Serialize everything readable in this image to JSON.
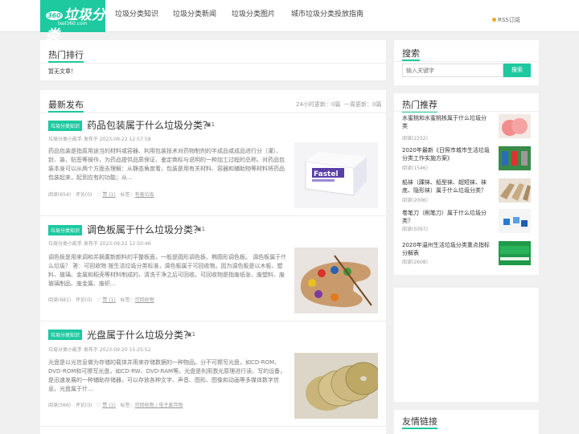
{
  "header": {
    "logo_main": "垃圾分类",
    "logo_num": "360",
    "logo_sub": "lxel360.com",
    "nav": [
      "垃圾分类知识",
      "垃圾分类新闻",
      "垃圾分类图片",
      "城市垃圾分类投放指南"
    ],
    "rss": "RSS订阅"
  },
  "hot_rank": {
    "title": "热门排行",
    "empty": "暂无文章！"
  },
  "latest": {
    "title": "最新发布",
    "stat_24h": "24小时更新：0篇",
    "stat_week": "一周更新：0篇",
    "posts": [
      {
        "tag": "垃圾分类知识",
        "title": "药品包装属于什么垃圾分类？",
        "img_count": "1",
        "meta": "垃圾分类小能手 发布于 2023-09-22 12:57:58",
        "excerpt": "药品包装是指原用途当的材料或容器、利用包装技术对药物制剂的半成品或成品进行分（灌）、封、装、贴签等操作，为药品提供品质保证、鉴定商标与说明的一种加工过程的总称。对药品包装本身可以从两个方面去理解：从静态角度看，包装是用有关材料、容器和辅助物等材料将药品包装起来，起到应有的功能；从...",
        "reads": "阅读(654)",
        "comments": "评论(0)",
        "likes": "赞 (1)",
        "tags_label": "标签：",
        "tags": "有害垃圾"
      },
      {
        "tag": "垃圾分类知识",
        "title": "调色板属于什么垃圾分类？",
        "img_count": "1",
        "meta": "垃圾分类小能手 发布于 2023-09-22 12:50:46",
        "excerpt": "调色板是用来调和并摘置新颜料的平整板面，一般是圆形调色板、椭圆形调色板。 调色板属于什么垃圾？ 答：可回收物 按生活垃圾分类标准，调色板属于可回收物。因为调色板是以木板、塑料、玻璃、金属和稻壳等材料制成的，清洗干净之后可回收。可回收物是指废纸张、废塑料、废玻璃制品、废金属、废织...",
        "reads": "阅读(681)",
        "comments": "评论(0)",
        "likes": "赞 (1)",
        "tags_label": "标签：",
        "tags": "可回收物"
      },
      {
        "tag": "垃圾分类知识",
        "title": "光盘属于什么垃圾分类？",
        "img_count": "1",
        "meta": "垃圾分类小能手 发布于 2023-09-20 15:25:52",
        "excerpt": "光盘是以光信息做为存储的载体并用来存储数据的一种物品。分不可擦写光盘，如CD-ROM、DVD-ROM和可擦写光盘，如CD-RW、DVD-RAM等。光盘是利用激光原理进行读、写的设备，是迅速发展的一种辅助存储器，可以存放各种文字、声音、图形、图像和动画等多媒体数字信息。光盘属于什...",
        "reads": "阅读(566)",
        "comments": "评论(0)",
        "likes": "赞 (1)",
        "tags_label": "标签：",
        "tags": "可回收物 / 电子废弃物"
      }
    ]
  },
  "search": {
    "title": "搜索",
    "placeholder": "输入关键字",
    "button": "搜索"
  },
  "recommend": {
    "title": "热门推荐",
    "items": [
      {
        "title": "水蜜桃和水蜜桃核属于什么垃圾分类",
        "reads": "阅读(2252)"
      },
      {
        "title": "2020年最新《日照市城市生活垃圾分类工作实施方案》",
        "reads": "阅读(1546)"
      },
      {
        "title": "船袜（踝袜、船型袜、超短袜、袜底、隐形袜）属于什么垃圾分类？",
        "reads": "阅读(2006)"
      },
      {
        "title": "卷笔刀（削笔刀）属于什么垃圾分类？",
        "reads": "阅读(5097)"
      },
      {
        "title": "2020年温州生活垃圾分类重点指标分解表",
        "reads": "阅读(2608)"
      }
    ]
  },
  "links": {
    "title": "友情链接"
  },
  "colors": {
    "accent": "#1ec9a0",
    "bg": "#f0f0f0"
  }
}
